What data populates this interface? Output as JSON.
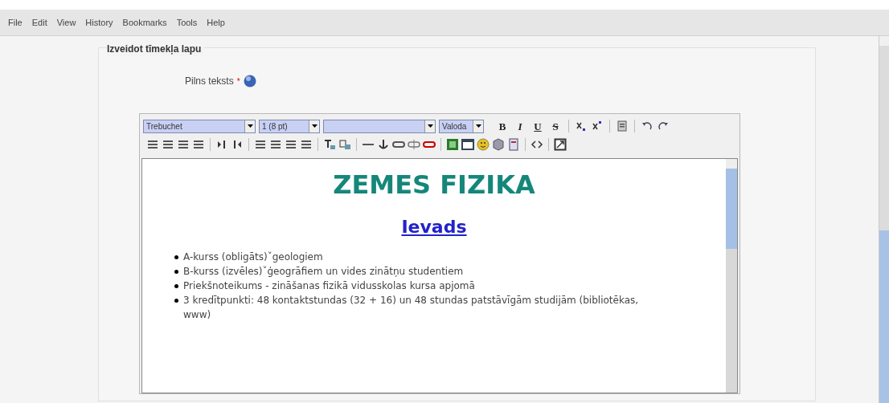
{
  "menu": [
    "File",
    "Edit",
    "View",
    "History",
    "Bookmarks",
    "Tools",
    "Help"
  ],
  "form_title": "Izveidot tīmekļa lapu",
  "field": {
    "label": "Pilns teksts",
    "required_mark": "*"
  },
  "toolbar": {
    "selects": [
      {
        "kind": "filled",
        "value": "Trebuchet"
      },
      {
        "kind": "filled",
        "value": "1 (8 pt)"
      },
      {
        "kind": "blank"
      },
      {
        "kind": "filled",
        "value": "Valoda"
      }
    ],
    "format_buttons": [
      {
        "label": "B",
        "kind": "bold"
      },
      {
        "label": "I",
        "kind": "italic"
      },
      {
        "label": "U",
        "kind": "underline"
      },
      {
        "label": "S",
        "kind": "strike"
      }
    ]
  },
  "content": {
    "title": "ZEMES FIZIKA",
    "heading_link": "Ievads",
    "bullets": [
      "A-kurss (obligāts)ˇgeologiem",
      "B-kurss (izvēles)ˇģeogrāfiem un vides zinātņu studentiem",
      "Priekšnoteikums - zināšanas fizikā vidusskolas kursa apjomā",
      "3 kredītpunkti: 48 kontaktstundas (32 + 16) un 48 stundas patstāvīgām studijām (bibliotēkas, www)"
    ]
  }
}
